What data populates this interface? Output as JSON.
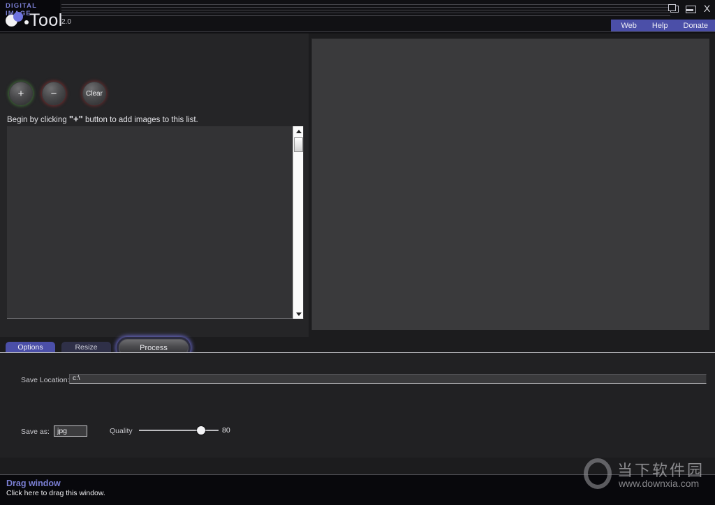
{
  "window": {
    "brand_kicker": "DIGITAL IMAGE",
    "logo_word": "Tool",
    "version": "2.0",
    "controls": [
      {
        "name": "restore",
        "label": ""
      },
      {
        "name": "minimize",
        "label": ""
      },
      {
        "name": "close",
        "label": "X"
      }
    ]
  },
  "nav": {
    "web": "Web",
    "help": "Help",
    "donate": "Donate"
  },
  "toolbar": {
    "add_label": "+",
    "remove_label": "−",
    "clear_label": "Clear"
  },
  "list": {
    "hint_prefix": "Begin by clicking ",
    "hint_plus": "\"+\"",
    "hint_suffix": " button  to add images to this list."
  },
  "actions": {
    "process_label": "Process"
  },
  "tabs": [
    {
      "label": "Options",
      "active": true
    },
    {
      "label": "Resize",
      "active": false
    }
  ],
  "options": {
    "save_location_label": "Save Location:",
    "save_location_value": "c:\\",
    "save_location_placeholder": "c:\\",
    "save_as_label": "Save as:",
    "save_as_value": "jpg",
    "quality_label": "Quality",
    "quality_value": "80"
  },
  "footer": {
    "drag_title": "Drag window",
    "drag_subtitle": "Click here to drag this window."
  },
  "watermark": {
    "cn_text": "当下软件园",
    "url": "www.downxia.com"
  },
  "colors": {
    "accent_purple": "#4b4fa8",
    "brand_purple": "#7b7fd4",
    "panel_dark": "#212123",
    "preview_gray": "#3a3a3c"
  }
}
